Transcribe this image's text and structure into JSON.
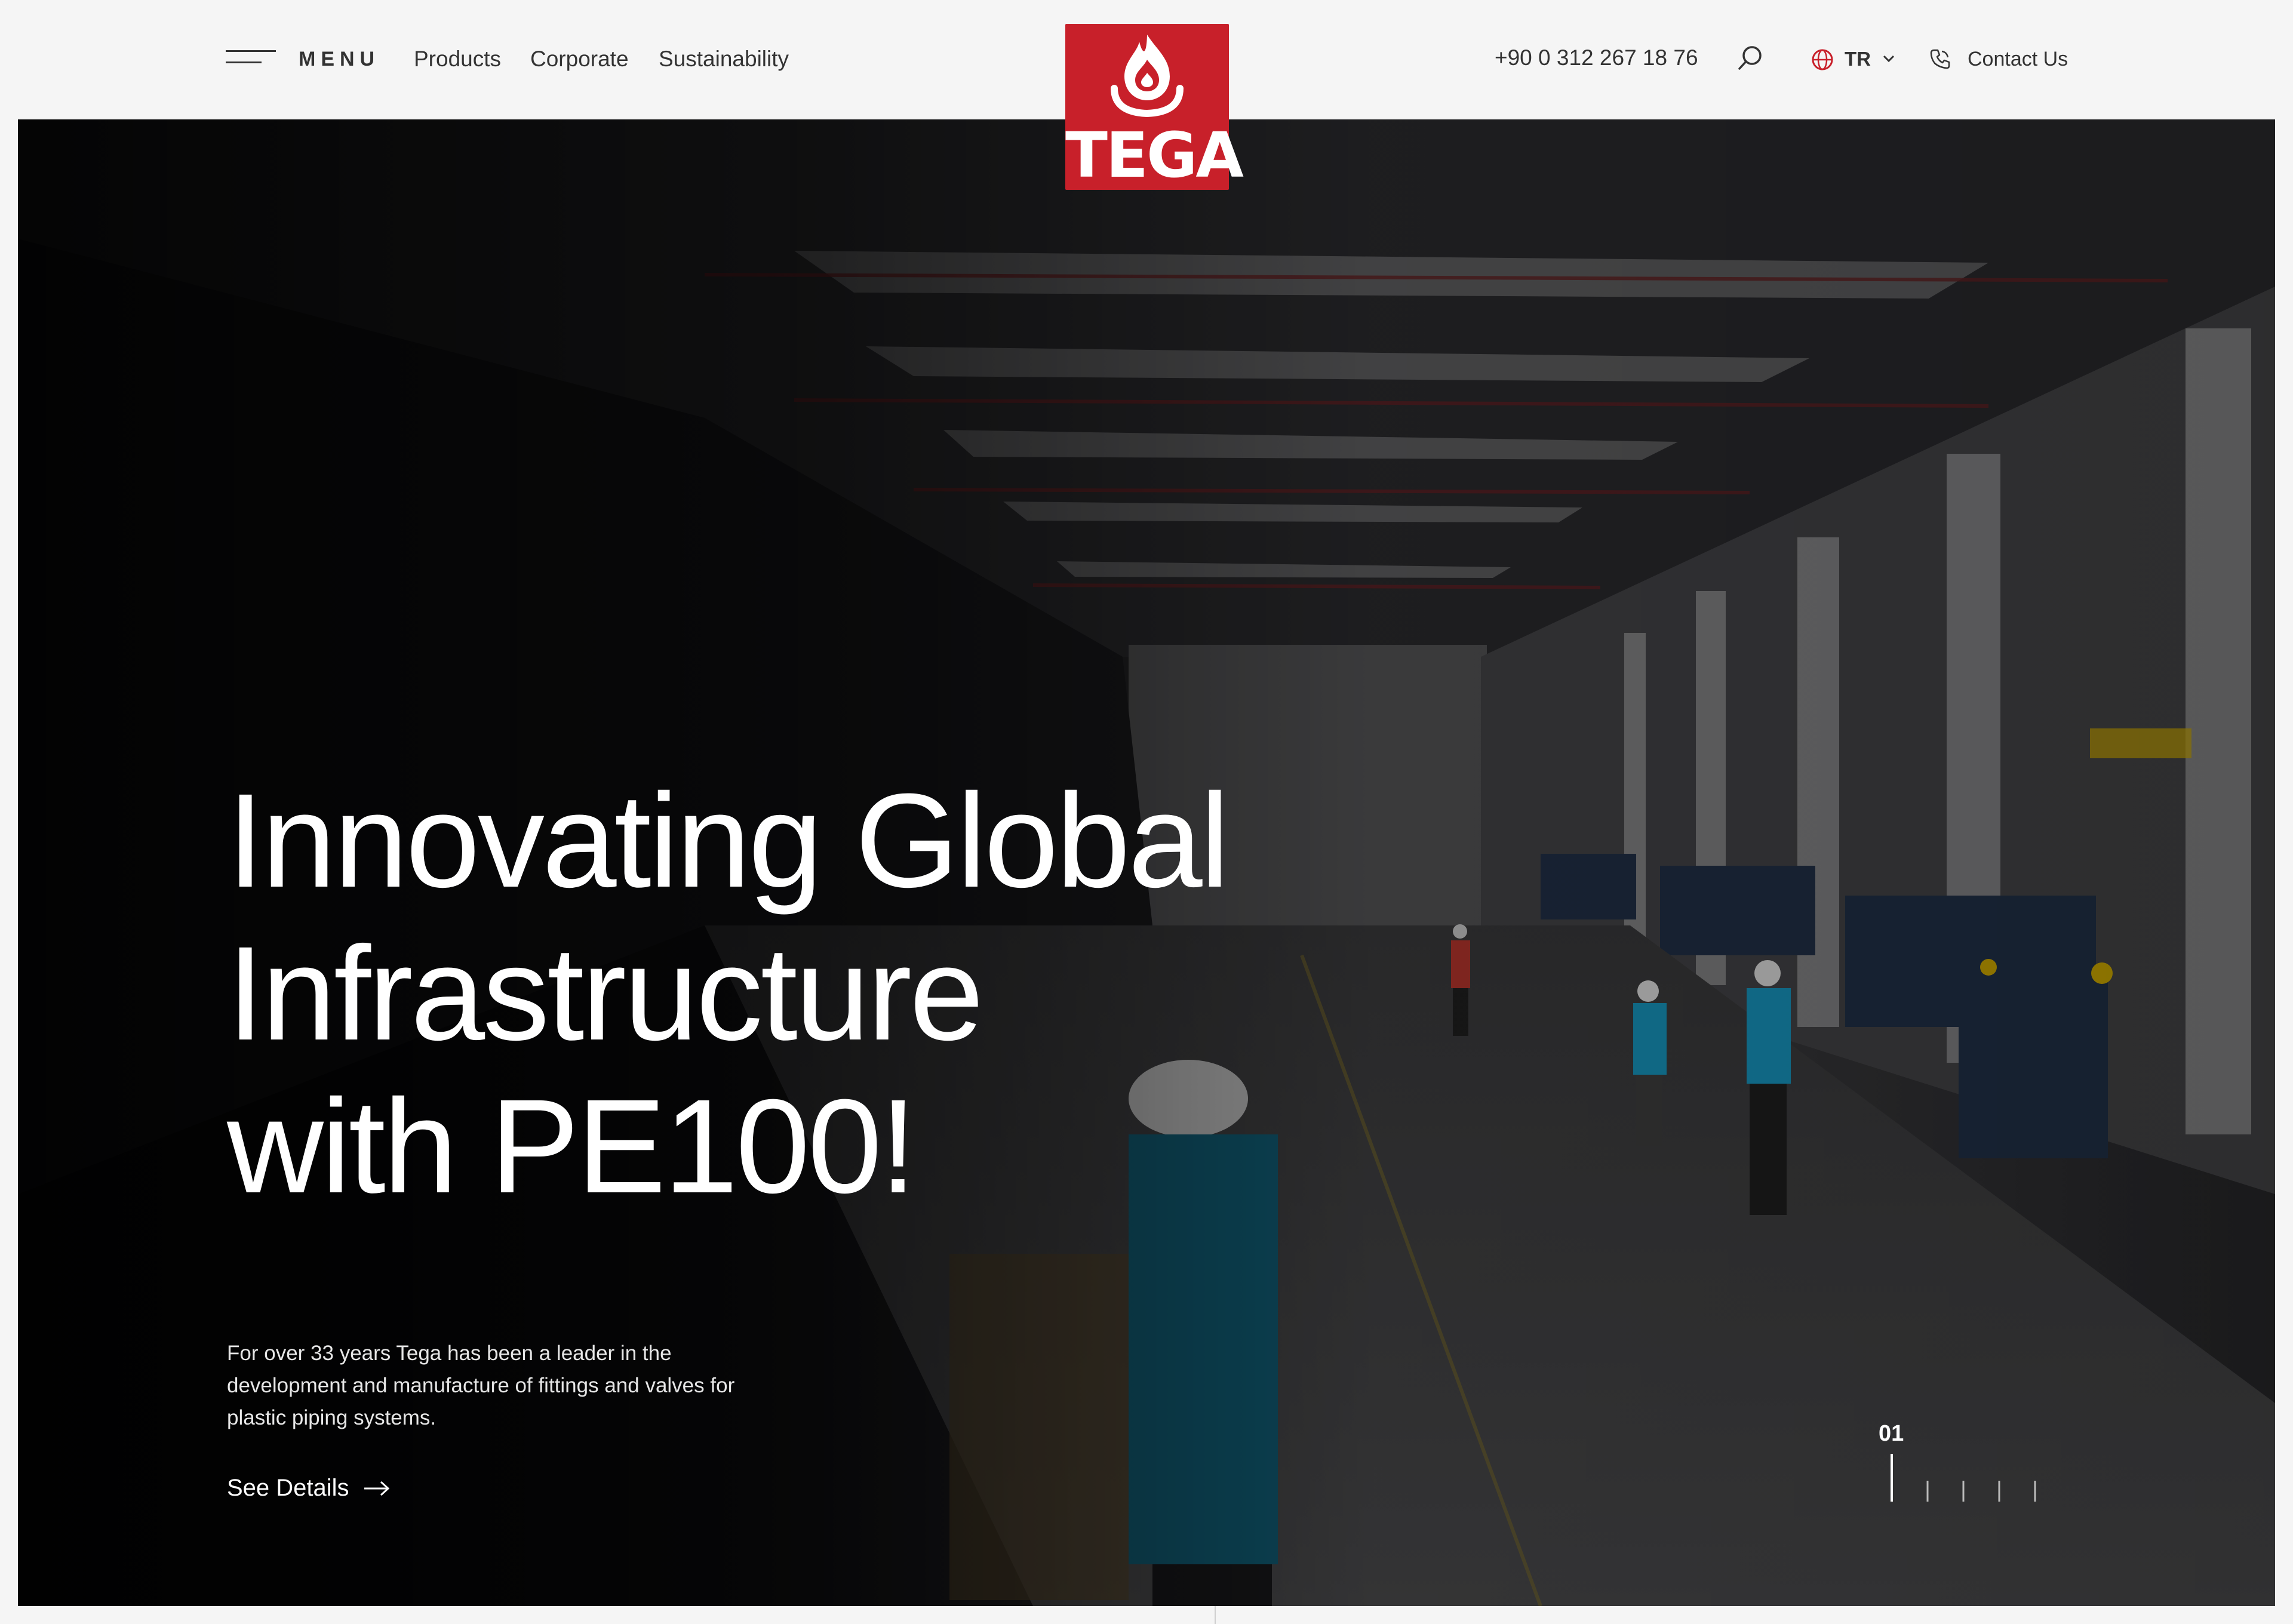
{
  "header": {
    "menu_label": "MENU",
    "nav": [
      "Products",
      "Corporate",
      "Sustainability"
    ],
    "logo_text": "TEGA",
    "phone": "+90 0 312 267 18 76",
    "language": "TR",
    "contact_label": "Contact Us"
  },
  "hero": {
    "headline_lines": [
      "Innovating Global",
      "Infrastructure",
      "with PE100!"
    ],
    "intro": "For over 33 years Tega has been a leader in the development and manufacture of fittings and valves for plastic piping systems.",
    "cta_label": "See Details",
    "slide_number": "01"
  },
  "colors": {
    "brand_red": "#c8202a",
    "accent_yellow": "#e0b800",
    "vest_blue": "#1aa3d0"
  },
  "icons": [
    "menu-icon",
    "search-icon",
    "globe-icon",
    "chevron-down-icon",
    "phone-icon",
    "arrow-right-icon"
  ]
}
